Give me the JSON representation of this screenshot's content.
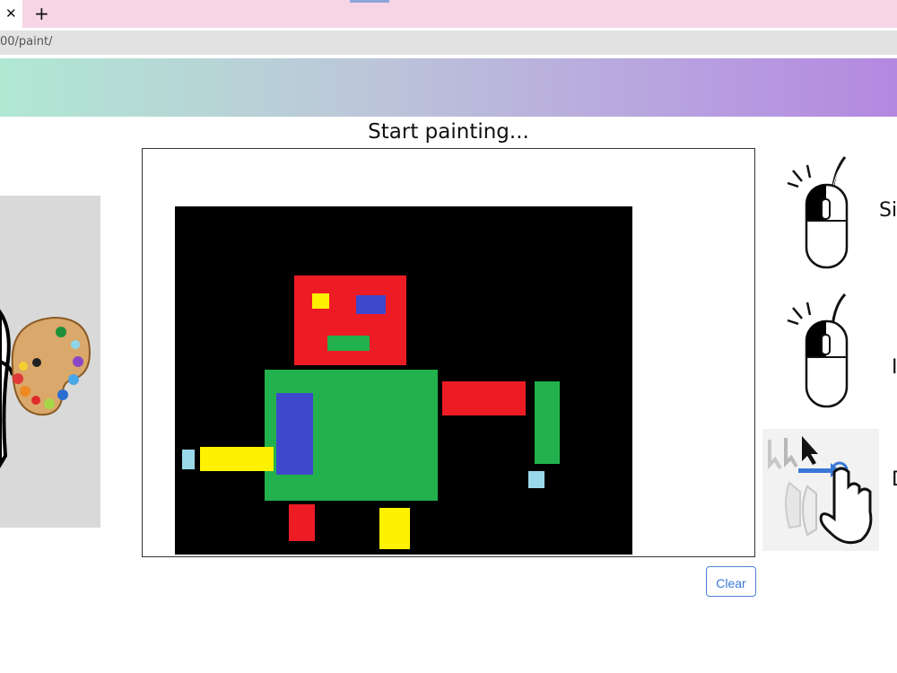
{
  "browser": {
    "tab_close": "✕",
    "new_tab": "+",
    "url": "00/paint/"
  },
  "page": {
    "heading": "Start painting..."
  },
  "canvas": {
    "background": "#000000",
    "shapes": [
      {
        "name": "robot-head",
        "color": "#ed1c24"
      },
      {
        "name": "robot-left-eye",
        "color": "#fff200"
      },
      {
        "name": "robot-right-eye",
        "color": "#3f48cc"
      },
      {
        "name": "robot-mouth",
        "color": "#22b14c"
      },
      {
        "name": "robot-body",
        "color": "#22b14c"
      },
      {
        "name": "robot-body-panel",
        "color": "#3f48cc"
      },
      {
        "name": "robot-left-arm",
        "color": "#fff200"
      },
      {
        "name": "robot-left-hand",
        "color": "#99d9ea"
      },
      {
        "name": "robot-right-arm",
        "color": "#ed1c24"
      },
      {
        "name": "robot-right-forearm",
        "color": "#22b14c"
      },
      {
        "name": "robot-right-hand",
        "color": "#99d9ea"
      },
      {
        "name": "robot-left-leg",
        "color": "#ed1c24"
      },
      {
        "name": "robot-right-leg",
        "color": "#fff200"
      }
    ]
  },
  "controls": {
    "clear_label": "Clear"
  },
  "instructions": {
    "item1_text": "Si",
    "item2_text": "I",
    "item3_text": "D"
  },
  "icons": {
    "mouse_left_click": "mouse-left-click-icon",
    "mouse_left_drag": "mouse-left-press-icon",
    "touch_drag": "touch-drag-icon",
    "palette": "palette-icon"
  },
  "colors": {
    "accent": "#3a78d6",
    "tabbar": "#f6d5e4"
  }
}
